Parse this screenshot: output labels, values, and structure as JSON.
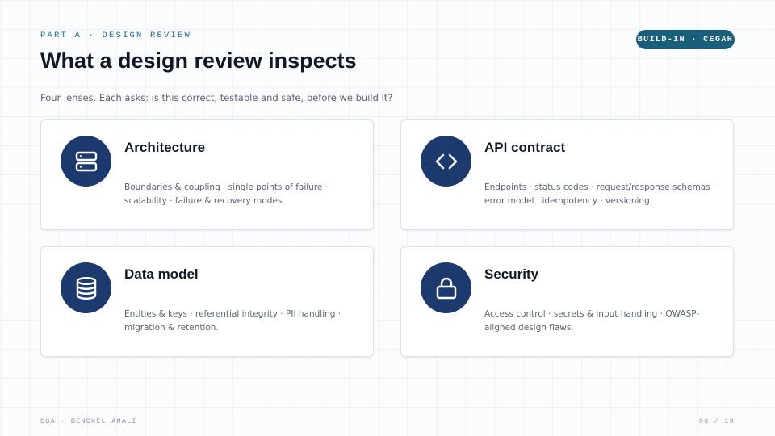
{
  "header": {
    "eyebrow": "PART A · DESIGN REVIEW",
    "badge": "BUILD-IN · CEGAH",
    "title": "What a design review inspects",
    "subtitle": "Four lenses.  Each asks: is this correct, testable and safe, before we build  it?"
  },
  "cards": [
    {
      "icon": "server-icon",
      "title": "Architecture",
      "description": "Boundaries & coupling · single points of failure · scalability · failure & recovery modes."
    },
    {
      "icon": "code-brackets-icon",
      "title": "API contract",
      "description": "Endpoints · status codes · request/response schemas · error model · idempotency · versioning."
    },
    {
      "icon": "database-icon",
      "title": "Data model",
      "description": "Entities & keys · referential integrity · PII handling · migration & retention."
    },
    {
      "icon": "lock-icon",
      "title": "Security",
      "description": "Access control · secrets & input handling · OWASP-aligned design flaws."
    }
  ],
  "footer": {
    "left": "SQA · BENGKEL AMALI",
    "page": "06 / 18"
  },
  "colors": {
    "accent": "#1a5f7a",
    "icon_bg": "#1c3a6e",
    "text": "#111827",
    "muted": "#5b6472"
  }
}
